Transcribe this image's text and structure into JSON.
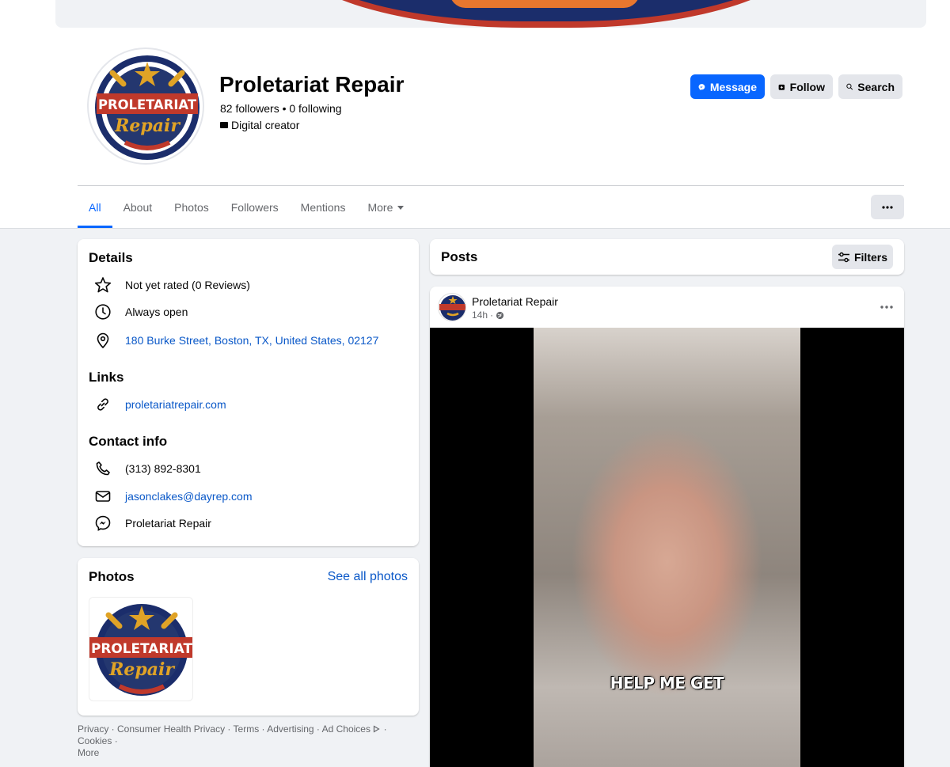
{
  "page": {
    "name": "Proletariat Repair",
    "followers_text": "82 followers • 0 following",
    "category": "Digital creator",
    "logo_text_top": "PROLETARIAT",
    "logo_text_bottom": "Repair"
  },
  "actions": {
    "message_label": "Message",
    "follow_label": "Follow",
    "search_label": "Search"
  },
  "tabs": [
    {
      "label": "All",
      "active": true
    },
    {
      "label": "About"
    },
    {
      "label": "Photos"
    },
    {
      "label": "Followers"
    },
    {
      "label": "Mentions"
    },
    {
      "label": "More"
    }
  ],
  "details": {
    "title": "Details",
    "rating": "Not yet rated (0 Reviews)",
    "hours": "Always open",
    "address": "180 Burke Street, Boston, TX, United States, 02127"
  },
  "links": {
    "title": "Links",
    "website": "proletariatrepair.com"
  },
  "contact": {
    "title": "Contact info",
    "phone": "(313) 892-8301",
    "email": "jasonclakes@dayrep.com",
    "messenger": "Proletariat Repair"
  },
  "photos": {
    "title": "Photos",
    "see_all": "See all photos"
  },
  "footer": {
    "links": [
      "Privacy",
      "Consumer Health Privacy",
      "Terms",
      "Advertising",
      "Ad Choices",
      "Cookies",
      "More"
    ]
  },
  "posts": {
    "title": "Posts",
    "filters_label": "Filters"
  },
  "post": {
    "author": "Proletariat Repair",
    "time": "14h",
    "video_caption": "HELP ME GET"
  },
  "colors": {
    "accent": "#0866ff",
    "link": "#0a58c8",
    "background": "#f0f2f5",
    "button_gray": "#e4e6eb",
    "secondary_text": "#65676b"
  }
}
